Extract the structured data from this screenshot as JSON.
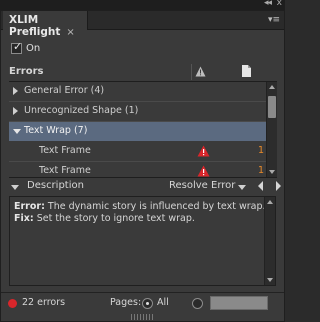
{
  "panel": {
    "title": "XLIM Preflight",
    "close_glyph": "×",
    "menu_glyph": "▾≡",
    "collapse_glyph": "◂◂",
    "window_close_glyph": "x"
  },
  "on_checkbox": {
    "label": "On",
    "checked": true
  },
  "errors_header": {
    "title": "Errors",
    "columns": [
      "warning-icon",
      "page-icon"
    ]
  },
  "errors_list": {
    "rows": [
      {
        "label": "General Error (4)",
        "expanded": false,
        "selected": false
      },
      {
        "label": "Unrecognized Shape (1)",
        "expanded": false,
        "selected": false
      },
      {
        "label": "Text Wrap (7)",
        "expanded": true,
        "selected": true
      },
      {
        "label": "Text Frame",
        "page": "1",
        "icon": "warning-icon"
      },
      {
        "label": "Text Frame",
        "page": "1",
        "icon": "warning-icon"
      }
    ]
  },
  "description_bar": {
    "label": "Description",
    "resolve_label": "Resolve Error"
  },
  "description": {
    "error_label": "Error:",
    "error_text": " The dynamic story is influenced by text wrap.",
    "fix_label": "Fix:",
    "fix_text": " Set the story to ignore text wrap."
  },
  "footer": {
    "error_count": "22 errors",
    "pages_label": "Pages:",
    "all_label": "All",
    "status_color": "#d8262b"
  }
}
